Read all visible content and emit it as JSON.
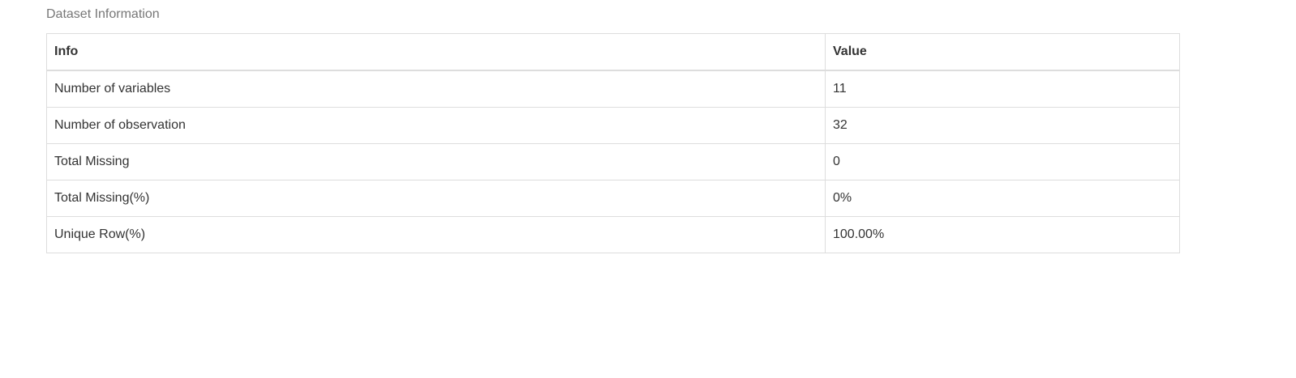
{
  "caption": "Dataset Information",
  "table": {
    "headers": [
      "Info",
      "Value"
    ],
    "rows": [
      {
        "info": "Number of variables",
        "value": "11"
      },
      {
        "info": "Number of observation",
        "value": "32"
      },
      {
        "info": "Total Missing",
        "value": "0"
      },
      {
        "info": "Total Missing(%)",
        "value": "0%"
      },
      {
        "info": "Unique Row(%)",
        "value": "100.00%"
      }
    ]
  }
}
